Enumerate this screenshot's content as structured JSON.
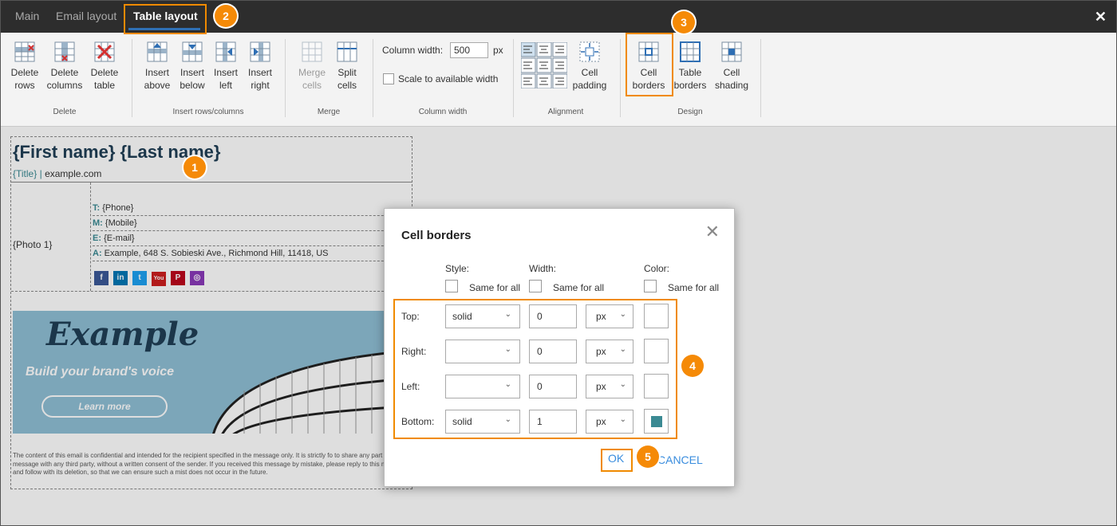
{
  "tabs": [
    "Main",
    "Email layout",
    "Table layout"
  ],
  "ribbon": {
    "delete_group": {
      "label": "Delete",
      "buttons": [
        [
          "Delete",
          "rows"
        ],
        [
          "Delete",
          "columns"
        ],
        [
          "Delete",
          "table"
        ]
      ]
    },
    "insert_group": {
      "label": "Insert rows/columns",
      "buttons": [
        [
          "Insert",
          "above"
        ],
        [
          "Insert",
          "below"
        ],
        [
          "Insert",
          "left"
        ],
        [
          "Insert",
          "right"
        ]
      ]
    },
    "merge_group": {
      "label": "Merge",
      "buttons": [
        [
          "Merge",
          "cells"
        ],
        [
          "Split",
          "cells"
        ]
      ]
    },
    "column_width_group": {
      "label": "Column width",
      "field_label": "Column width:",
      "value": "500",
      "unit": "px",
      "scale_label": "Scale to available width"
    },
    "alignment_group": {
      "label": "Alignment",
      "padding": [
        "Cell",
        "padding"
      ]
    },
    "design_group": {
      "label": "Design",
      "buttons": [
        [
          "Cell",
          "borders"
        ],
        [
          "Table",
          "borders"
        ],
        [
          "Cell",
          "shading"
        ]
      ]
    }
  },
  "signature": {
    "name": "{First name} {Last name}",
    "title": "{Title}",
    "separator": "|",
    "website": "example.com",
    "photo": "{Photo 1}",
    "lines": [
      {
        "key": "T:",
        "value": "{Phone}"
      },
      {
        "key": "M:",
        "value": "{Mobile}"
      },
      {
        "key": "E:",
        "value": "{E-mail}"
      },
      {
        "key": "A:",
        "value": "Example, 648 S. Sobieski Ave., Richmond Hill, 11418, US"
      }
    ],
    "socials": [
      {
        "icon": "facebook-icon",
        "glyph": "f",
        "color": "#3b5998"
      },
      {
        "icon": "linkedin-icon",
        "glyph": "in",
        "color": "#0077b5"
      },
      {
        "icon": "twitter-icon",
        "glyph": "t",
        "color": "#1da1f2"
      },
      {
        "icon": "youtube-icon",
        "glyph": "You",
        "color": "#cd201f"
      },
      {
        "icon": "pinterest-icon",
        "glyph": "P",
        "color": "#bd081c"
      },
      {
        "icon": "instagram-icon",
        "glyph": "◎",
        "color": "#8a3ab9"
      }
    ],
    "banner": {
      "logo": "Example",
      "tagline": "Build your brand's voice",
      "button": "Learn more"
    },
    "disclaimer": "The content of this email is confidential and intended for the recipient specified in the message only. It is strictly fo to share any part of this message with any third party, without a written consent of the sender. If you received this message by mistake, please reply to this message and follow with its deletion, so that we can ensure such a mist does not occur in the future."
  },
  "dialog": {
    "title": "Cell borders",
    "headers": {
      "style": "Style:",
      "width": "Width:",
      "color": "Color:"
    },
    "same_for_all": "Same for all",
    "rows": [
      {
        "label": "Top:",
        "style": "solid",
        "width": "0",
        "unit": "px",
        "color": ""
      },
      {
        "label": "Right:",
        "style": "",
        "width": "0",
        "unit": "px",
        "color": ""
      },
      {
        "label": "Left:",
        "style": "",
        "width": "0",
        "unit": "px",
        "color": ""
      },
      {
        "label": "Bottom:",
        "style": "solid",
        "width": "1",
        "unit": "px",
        "color": "#3b8a93"
      }
    ],
    "ok": "OK",
    "cancel": "CANCEL"
  },
  "annotations": [
    "1",
    "2",
    "3",
    "4",
    "5"
  ],
  "colors": {
    "accent": "#f08a00",
    "link": "#3a8dde",
    "teal": "#3b8a93",
    "title_bar": "#2d2d2d"
  }
}
